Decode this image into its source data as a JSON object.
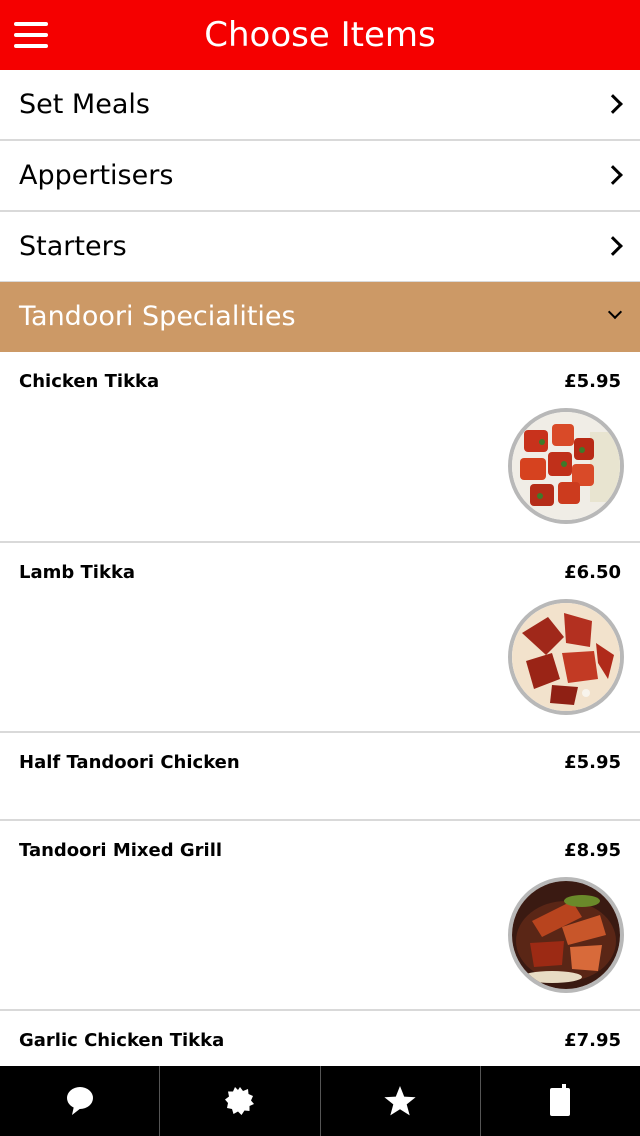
{
  "header": {
    "title": "Choose Items",
    "menu_icon": "hamburger-icon",
    "background": "#f50000"
  },
  "categories": [
    {
      "label": "Set Meals"
    },
    {
      "label": "Appertisers"
    },
    {
      "label": "Starters"
    }
  ],
  "expanded_category": {
    "label": "Tandoori Specialities",
    "background": "#cc9966"
  },
  "items": [
    {
      "name": "Chicken Tikka",
      "price": "£5.95",
      "has_image": true
    },
    {
      "name": "Lamb Tikka",
      "price": "£6.50",
      "has_image": true
    },
    {
      "name": "Half Tandoori Chicken",
      "price": "£5.95",
      "has_image": false
    },
    {
      "name": "Tandoori Mixed Grill",
      "price": "£8.95",
      "has_image": true
    },
    {
      "name": "Garlic Chicken Tikka",
      "price": "£7.95",
      "has_image": false
    }
  ],
  "tabbar": {
    "tabs": [
      {
        "icon": "speech-bubble-icon"
      },
      {
        "icon": "badge-icon"
      },
      {
        "icon": "star-icon"
      },
      {
        "icon": "phone-icon"
      }
    ]
  }
}
